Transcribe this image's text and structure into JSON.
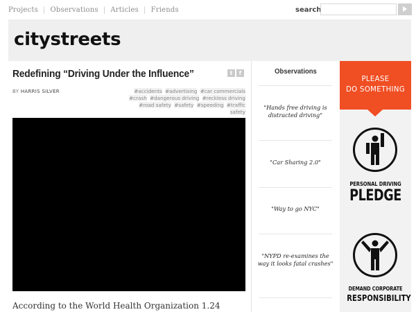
{
  "nav": {
    "items": [
      "Projects",
      "Observations",
      "Articles",
      "Friends"
    ],
    "search_label": "search",
    "search_value": "",
    "search_placeholder": ""
  },
  "header": {
    "logo": "citystreets"
  },
  "article": {
    "title": "Redefining “Driving Under the Influence”",
    "byline_prefix": "BY ",
    "author": "HARRIS SILVER",
    "tags": [
      "#accidents",
      "#advertising",
      "#car commercials",
      "#crash",
      "#dangerous driving",
      "#reckless driving",
      "#road safety",
      "#safety",
      "#speeding",
      "#traffic safety"
    ],
    "lead": "According to the World Health Organization 1.24",
    "share": {
      "twitter": "t",
      "facebook": "f"
    }
  },
  "observations": {
    "title": "Observations",
    "items": [
      "\"Hands free driving is distracted driving\"",
      "\"Car Sharing  2.0\"",
      "\"Way to go NYC\"",
      "\"NYPD re-examines the way it looks fatal crashes\""
    ]
  },
  "promo": {
    "cta_line1": "PLEASE",
    "cta_line2": "DO SOMETHING",
    "pledge_small": "PERSONAL DRIVING",
    "pledge_big": "PLEDGE",
    "demand_small": "DEMAND CORPORATE",
    "demand_big": "RESPONSIBILITY"
  },
  "colors": {
    "accent": "#f04e23",
    "header_bg": "#efefef",
    "video_bg": "#000000"
  },
  "icons": [
    "play-arrow-icon",
    "twitter-icon",
    "facebook-icon",
    "pledge-person-icon",
    "demand-person-icon"
  ]
}
